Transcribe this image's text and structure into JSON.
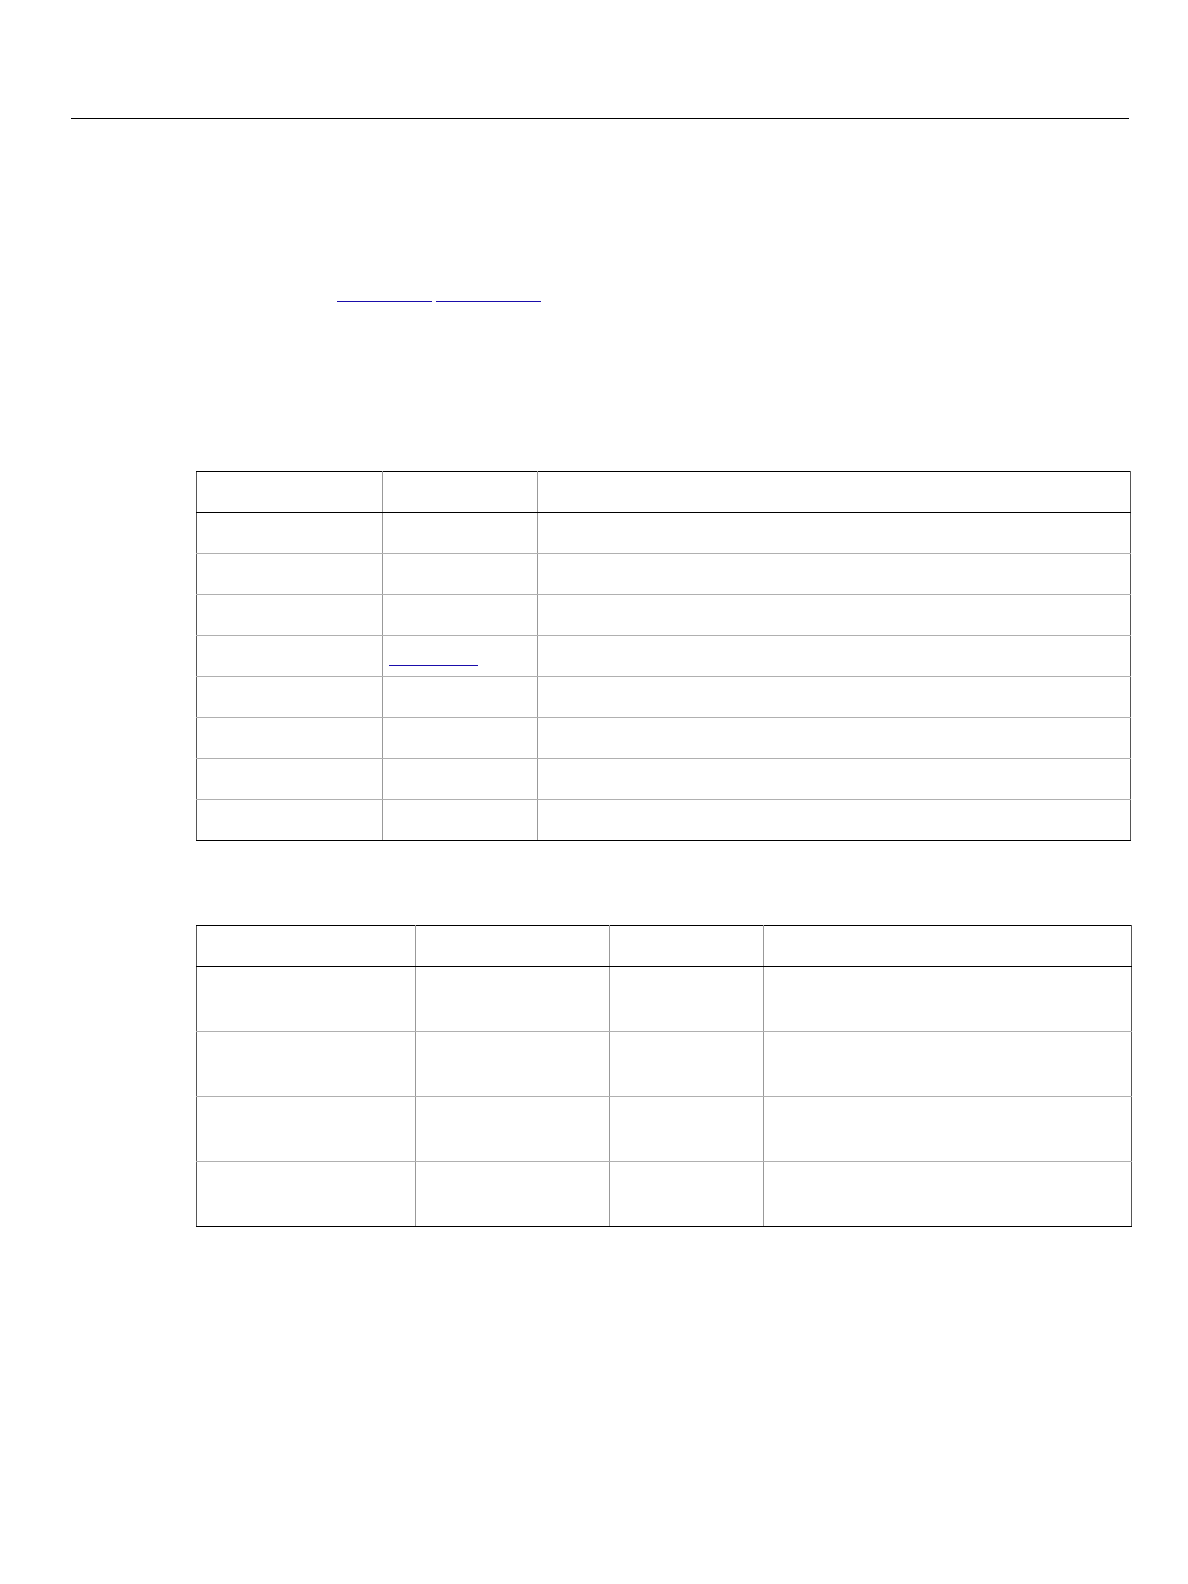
{
  "document": {
    "links": [
      {
        "label": ""
      },
      {
        "label": ""
      }
    ]
  },
  "table_1": {
    "headers": [
      "",
      "",
      ""
    ],
    "rows": [
      [
        "",
        "",
        ""
      ],
      [
        "",
        "",
        ""
      ],
      [
        "",
        "",
        ""
      ],
      [
        "",
        "",
        ""
      ],
      [
        "",
        "",
        ""
      ],
      [
        "",
        "",
        ""
      ],
      [
        "",
        "",
        ""
      ],
      [
        "",
        "",
        ""
      ]
    ],
    "link_cell": {
      "row": 3,
      "column": 1,
      "label": ""
    }
  },
  "table_2": {
    "headers": [
      "",
      "",
      "",
      ""
    ],
    "rows": [
      [
        "",
        "",
        "",
        ""
      ],
      [
        "",
        "",
        "",
        ""
      ],
      [
        "",
        "",
        "",
        ""
      ],
      [
        "",
        "",
        "",
        ""
      ]
    ]
  },
  "colors": {
    "link": "#1a0dab",
    "rule": "#000000",
    "grid_line": "#999999"
  }
}
